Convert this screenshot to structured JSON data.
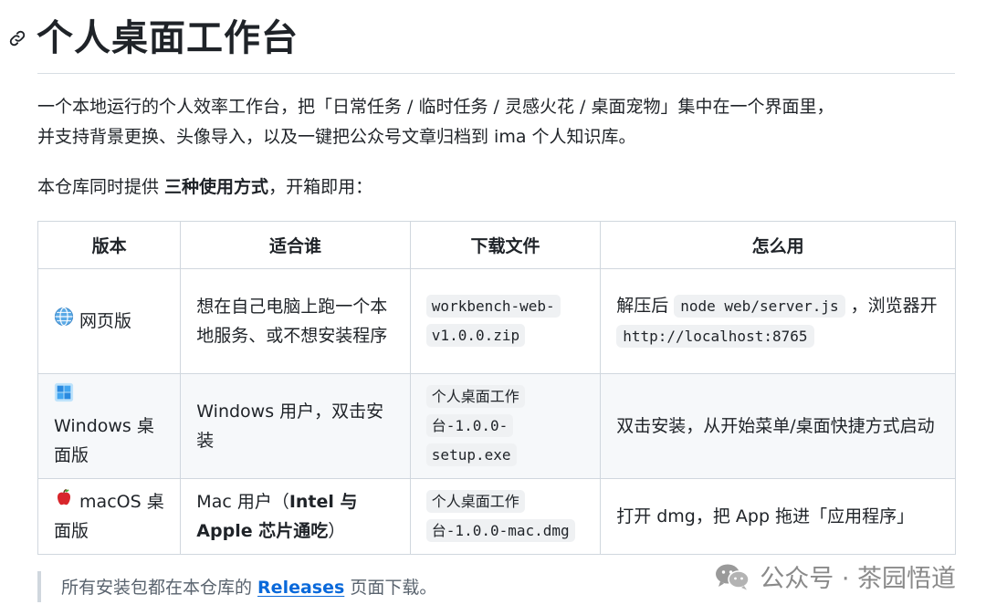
{
  "heading": {
    "title": "个人桌面工作台",
    "anchor_icon": "link-icon"
  },
  "intro": {
    "line1": "一个本地运行的个人效率工作台，把「日常任务 / 临时任务 / 灵感火花 / 桌面宠物」集中在一个界面里，",
    "line2": "并支持背景更换、头像导入，以及一键把公众号文章归档到 ima 个人知识库。"
  },
  "lead": {
    "before": "本仓库同时提供 ",
    "strong": "三种使用方式",
    "after": "，开箱即用："
  },
  "table": {
    "headers": [
      "版本",
      "适合谁",
      "下载文件",
      "怎么用"
    ],
    "rows": [
      {
        "icon": "globe-icon",
        "version": "网页版",
        "audience": "想在自己电脑上跑一个本地服务、或不想安装程序",
        "file": "workbench-web-v1.0.0.zip",
        "usage_before": "解压后 ",
        "usage_code1": "node web/server.js",
        "usage_mid": " ，浏览器开 ",
        "usage_code2": "http://localhost:8765"
      },
      {
        "icon": "windows-icon",
        "version": "Windows 桌面版",
        "audience": "Windows 用户，双击安装",
        "file": "个人桌面工作台-1.0.0-setup.exe",
        "usage": "双击安装，从开始菜单/桌面快捷方式启动"
      },
      {
        "icon": "apple-icon",
        "version": "macOS 桌面版",
        "audience_before": "Mac 用户（",
        "audience_strong": "Intel 与 Apple 芯片通吃",
        "audience_after": "）",
        "file": "个人桌面工作台-1.0.0-mac.dmg",
        "usage": "打开 dmg，把 App 拖进「应用程序」"
      }
    ]
  },
  "note": {
    "before": "所有安装包都在本仓库的 ",
    "link": "Releases",
    "after": " 页面下载。"
  },
  "watermark": {
    "text": "公众号 · 茶园悟道",
    "icon": "wechat-icon"
  },
  "colors": {
    "link": "#0969da",
    "border": "#d0d7de",
    "code_bg": "#eff1f3",
    "stripe": "#f6f8fa"
  }
}
